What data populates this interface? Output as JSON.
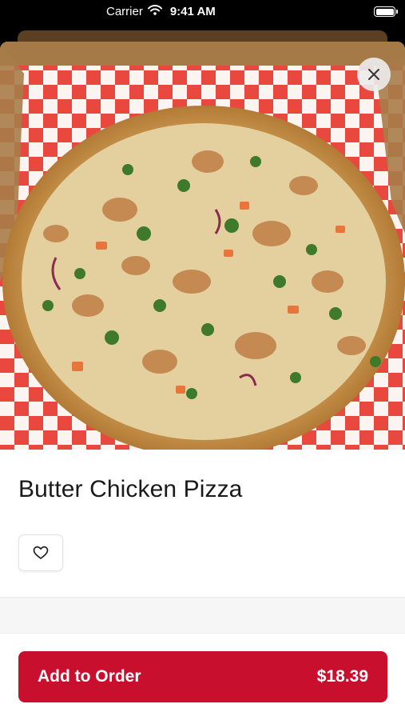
{
  "status_bar": {
    "carrier": "Carrier",
    "time": "9:41 AM"
  },
  "hero": {
    "image_alt": "Butter Chicken Pizza photo",
    "close_icon": "close-icon"
  },
  "item": {
    "title": "Butter Chicken Pizza",
    "favorite_icon": "heart-outline-icon"
  },
  "order_button": {
    "label": "Add to Order",
    "price": "$18.39",
    "background": "#c8102e"
  }
}
